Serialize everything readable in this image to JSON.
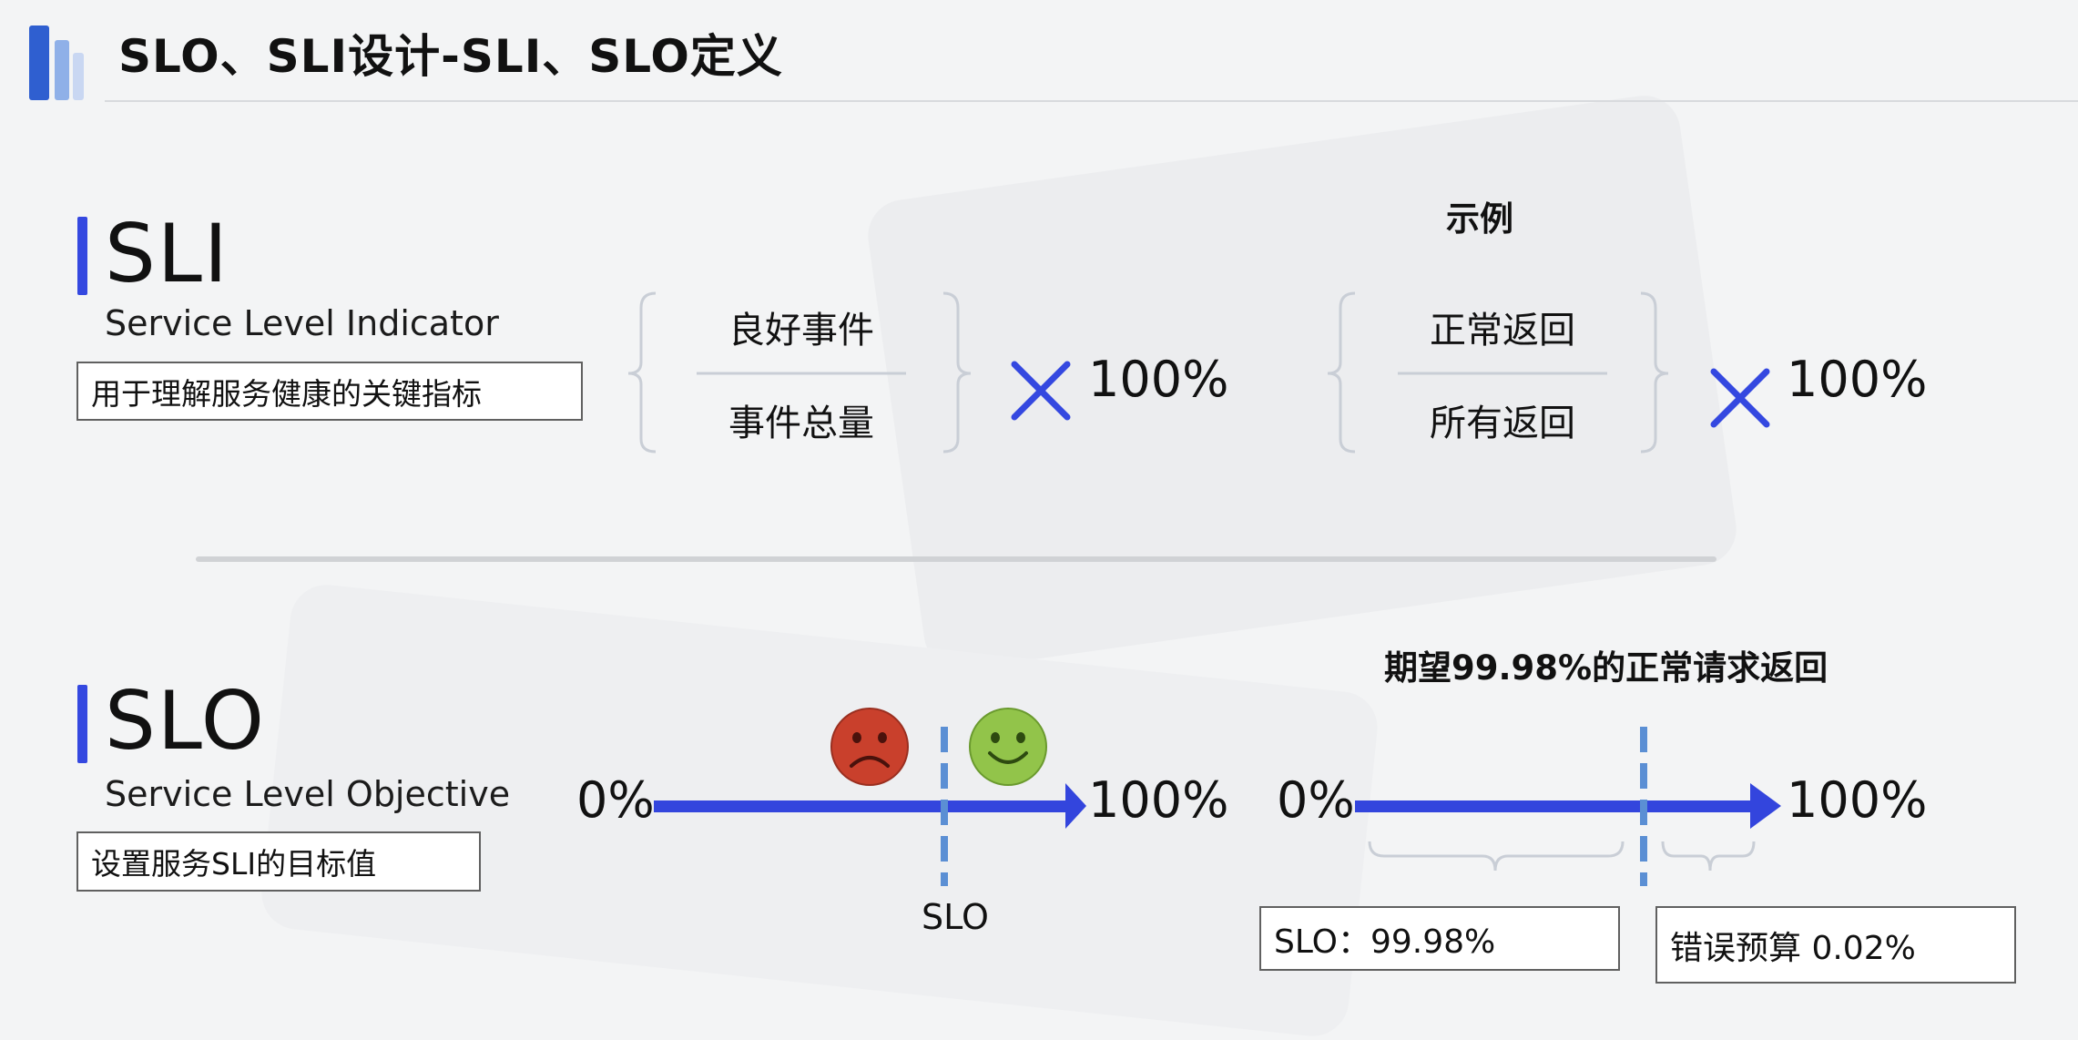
{
  "header": {
    "title": "SLO、SLI设计-SLI、SLO定义"
  },
  "sli": {
    "heading": "SLI",
    "full_name": "Service Level Indicator",
    "description": "用于理解服务健康的关键指标",
    "formula": {
      "numerator": "良好事件",
      "denominator": "事件总量",
      "percent": "100%"
    },
    "example_label": "示例",
    "example": {
      "numerator": "正常返回",
      "denominator": "所有返回",
      "percent": "100%"
    }
  },
  "slo": {
    "heading": "SLO",
    "full_name": "Service Level Objective",
    "description": "设置服务SLI的目标值",
    "scale": {
      "start": "0%",
      "end": "100%",
      "marker_label": "SLO"
    },
    "example_label": "期望99.98%的正常请求返回",
    "example_scale": {
      "start": "0%",
      "end": "100%"
    },
    "slo_box": "SLO：99.98%",
    "error_budget_box": "错误预算 0.02%"
  },
  "colors": {
    "accent_blue": "#3448e0",
    "arrow_blue": "#3345dd",
    "marker_blue": "#5b8fd4",
    "sad_face": "#c9402c",
    "happy_face": "#92c44a"
  },
  "icons": [
    "sad-face-icon",
    "happy-face-icon",
    "multiply-icon"
  ]
}
